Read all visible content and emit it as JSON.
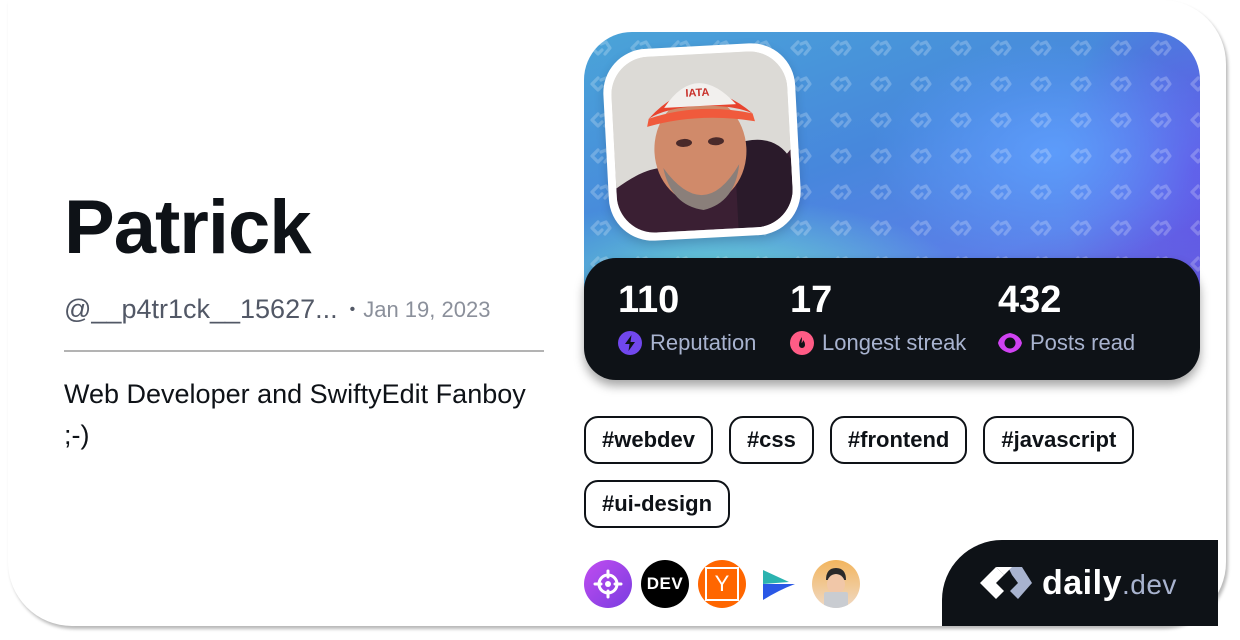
{
  "profile": {
    "name": "Patrick",
    "handle": "@__p4tr1ck__15627...",
    "separator": "•",
    "joined": "Jan 19, 2023",
    "bio": "Web Developer and SwiftyEdit Fanboy ;-)"
  },
  "stats": [
    {
      "value": "110",
      "label": "Reputation",
      "icon": "lightning-icon",
      "color": "#7147ed"
    },
    {
      "value": "17",
      "label": "Longest streak",
      "icon": "flame-icon",
      "color": "#ff5c86"
    },
    {
      "value": "432",
      "label": "Posts read",
      "icon": "eye-icon",
      "color": "#d042f2"
    }
  ],
  "tags": [
    "#webdev",
    "#css",
    "#frontend",
    "#javascript",
    "#ui-design"
  ],
  "sources": [
    {
      "name": "crosshair-source-icon",
      "label": "",
      "color": "#9d3ce0"
    },
    {
      "name": "dev-to-source-icon",
      "label": "DEV",
      "color": "#000000"
    },
    {
      "name": "hacker-news-source-icon",
      "label": "Y",
      "color": "#ff6600"
    },
    {
      "name": "play-arrow-source-icon",
      "label": "",
      "color": "#2a58e6"
    },
    {
      "name": "devsquad-avatar-source-icon",
      "label": "",
      "color": "#f0b060"
    }
  ],
  "brand": {
    "name": "daily",
    "tld": ".dev"
  },
  "colors": {
    "background": "#ffffff",
    "dark": "#0e1217",
    "muted": "#a8b3cf"
  }
}
